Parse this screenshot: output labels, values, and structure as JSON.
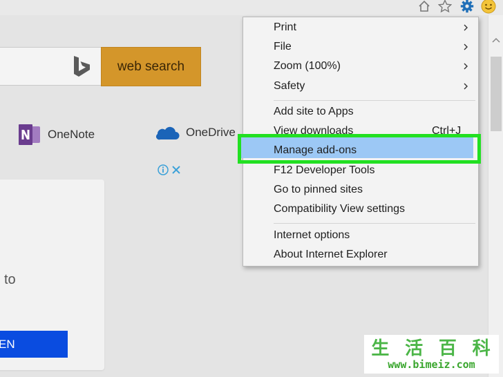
{
  "browser": {
    "toolbar_icons": [
      "home-icon",
      "favorites-star-icon",
      "tools-gear-icon",
      "feedback-smiley-icon"
    ]
  },
  "page": {
    "search_button_label": "web search",
    "apps": [
      {
        "label": "OneNote",
        "icon": "onenote-icon"
      },
      {
        "label": "OneDrive",
        "icon": "onedrive-cloud-icon"
      }
    ],
    "card": {
      "text_fragment": "to",
      "button_fragment": "EN"
    }
  },
  "tools_menu": {
    "items": [
      {
        "label": "Print",
        "submenu": true
      },
      {
        "label": "File",
        "submenu": true
      },
      {
        "label": "Zoom (100%)",
        "submenu": true
      },
      {
        "label": "Safety",
        "submenu": true
      },
      {
        "label": "Add site to Apps"
      },
      {
        "label": "View downloads",
        "shortcut": "Ctrl+J"
      },
      {
        "label": "Manage add-ons",
        "highlighted": true
      },
      {
        "label": "F12 Developer Tools"
      },
      {
        "label": "Go to pinned sites"
      },
      {
        "label": "Compatibility View settings"
      },
      {
        "label": "Internet options"
      },
      {
        "label": "About Internet Explorer"
      }
    ]
  },
  "watermark": {
    "title_chars": [
      "生",
      "活",
      "百",
      "科"
    ],
    "url": "www.bimeiz.com"
  },
  "colors": {
    "search_button": "#d4962a",
    "menu_highlight": "#9cc8f5",
    "focus_ring": "#22e022",
    "card_button": "#0a4ce0",
    "watermark_green": "#4cb648"
  }
}
